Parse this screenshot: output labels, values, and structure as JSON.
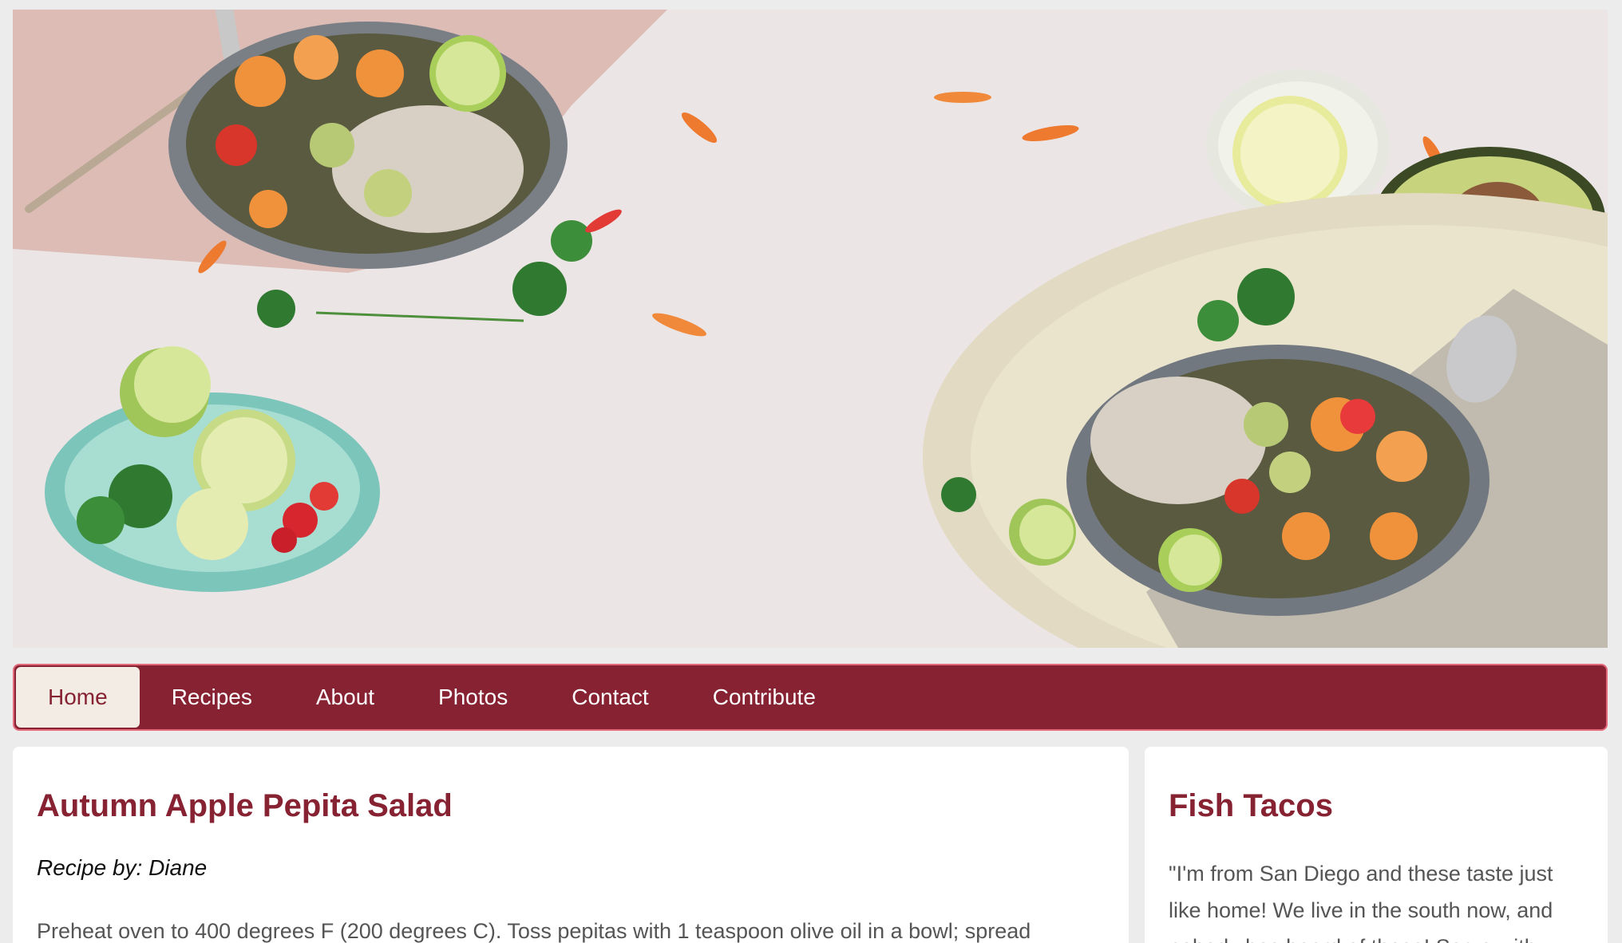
{
  "nav": {
    "items": [
      {
        "label": "Home",
        "active": true
      },
      {
        "label": "Recipes",
        "active": false
      },
      {
        "label": "About",
        "active": false
      },
      {
        "label": "Photos",
        "active": false
      },
      {
        "label": "Contact",
        "active": false
      },
      {
        "label": "Contribute",
        "active": false
      }
    ]
  },
  "main_recipe": {
    "title": "Autumn Apple Pepita Salad",
    "author": "Recipe by: Diane",
    "body": "Preheat oven to 400 degrees F (200 degrees C). Toss pepitas with 1 teaspoon olive oil in a bowl; spread"
  },
  "side_recipe": {
    "title": "Fish Tacos",
    "body": "\"I'm from San Diego and these taste just like home! We live in the south now, and nobody has heard of these! Serve with"
  },
  "colors": {
    "brand": "#862232",
    "nav_active_bg": "#f2ece4",
    "page_bg": "#ececec"
  }
}
